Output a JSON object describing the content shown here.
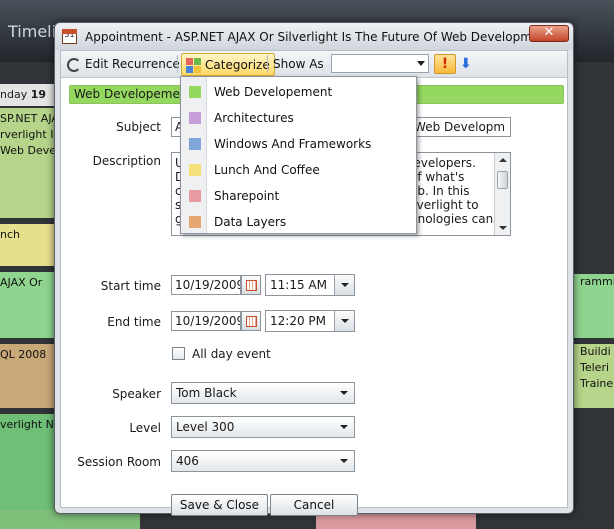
{
  "background": {
    "app_title": "Timeli",
    "day_label": "nday",
    "day_number": "19",
    "left_column": [
      {
        "text": "SP.NET AJA\nrverlight Is\nWeb Devel",
        "color": "#b6d48a"
      },
      {
        "text": "nch",
        "color": "#e6df8e"
      },
      {
        "text": "AJAX Or",
        "color": "#8fd48f"
      },
      {
        "text": "QL 2008",
        "color": "#c9a878"
      },
      {
        "text": "verlight N",
        "color": "#6fbf76"
      }
    ],
    "right_column": [
      {
        "text": "rammi",
        "color": "#8fd48f"
      },
      {
        "text": "Buildi\nTeleri\nTraine",
        "color": "#b6d48a"
      }
    ]
  },
  "dialog": {
    "title": "Appointment - ASP.NET AJAX Or Silverlight Is The Future Of Web Development",
    "title_icon_text": "31",
    "close_label": "✕"
  },
  "toolbar": {
    "edit_recurrence_label": "Edit Recurrence",
    "categorize_label": "Categorize",
    "show_as_label": "Show As",
    "show_as_value": "",
    "high_importance_label": "!",
    "low_importance_label": "⬇"
  },
  "category_bar": {
    "label": "Web Developement",
    "color": "#95d860"
  },
  "form": {
    "subject_label": "Subject",
    "subject_value_start": "A",
    "subject_value_end": "f Web Developm",
    "description_label": "Description",
    "description_left": "U\nD\nc\ns\ng",
    "description_right": "levelopers.\nof what's\neb. In this\nilverlight to\nnnologies can",
    "start_time_label": "Start time",
    "start_date": "10/19/2009",
    "start_time": "11:15 AM",
    "end_time_label": "End time",
    "end_date": "10/19/2009",
    "end_time": "12:20 PM",
    "all_day_label": "All day event",
    "speaker_label": "Speaker",
    "speaker_value": "Tom Black",
    "level_label": "Level",
    "level_value": "Level 300",
    "session_room_label": "Session Room",
    "session_room_value": "406"
  },
  "buttons": {
    "save_close": "Save & Close",
    "cancel": "Cancel"
  },
  "categories": [
    {
      "label": "Web Developement",
      "color": "#95d860"
    },
    {
      "label": "Architectures",
      "color": "#c79ed8"
    },
    {
      "label": "Windows And Frameworks",
      "color": "#7fa7dc"
    },
    {
      "label": "Lunch And Coffee",
      "color": "#f6e07a"
    },
    {
      "label": "Sharepoint",
      "color": "#e99aa0"
    },
    {
      "label": "Data Layers",
      "color": "#e4a870"
    }
  ]
}
